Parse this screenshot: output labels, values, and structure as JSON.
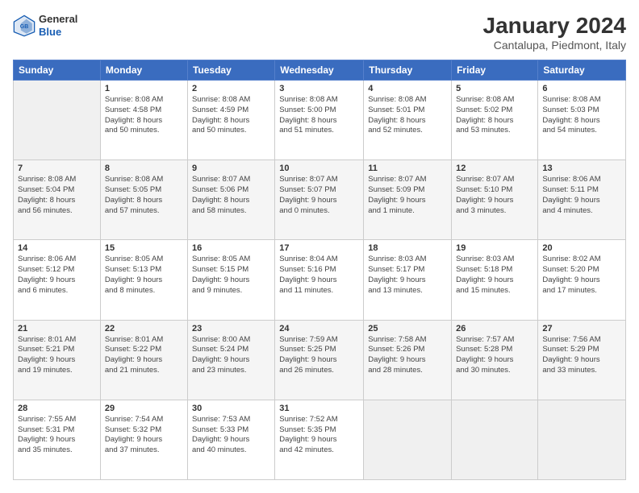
{
  "header": {
    "logo_general": "General",
    "logo_blue": "Blue",
    "month_title": "January 2024",
    "location": "Cantalupa, Piedmont, Italy"
  },
  "days_of_week": [
    "Sunday",
    "Monday",
    "Tuesday",
    "Wednesday",
    "Thursday",
    "Friday",
    "Saturday"
  ],
  "weeks": [
    [
      {
        "day": "",
        "info": ""
      },
      {
        "day": "1",
        "info": "Sunrise: 8:08 AM\nSunset: 4:58 PM\nDaylight: 8 hours\nand 50 minutes."
      },
      {
        "day": "2",
        "info": "Sunrise: 8:08 AM\nSunset: 4:59 PM\nDaylight: 8 hours\nand 50 minutes."
      },
      {
        "day": "3",
        "info": "Sunrise: 8:08 AM\nSunset: 5:00 PM\nDaylight: 8 hours\nand 51 minutes."
      },
      {
        "day": "4",
        "info": "Sunrise: 8:08 AM\nSunset: 5:01 PM\nDaylight: 8 hours\nand 52 minutes."
      },
      {
        "day": "5",
        "info": "Sunrise: 8:08 AM\nSunset: 5:02 PM\nDaylight: 8 hours\nand 53 minutes."
      },
      {
        "day": "6",
        "info": "Sunrise: 8:08 AM\nSunset: 5:03 PM\nDaylight: 8 hours\nand 54 minutes."
      }
    ],
    [
      {
        "day": "7",
        "info": "Sunrise: 8:08 AM\nSunset: 5:04 PM\nDaylight: 8 hours\nand 56 minutes."
      },
      {
        "day": "8",
        "info": "Sunrise: 8:08 AM\nSunset: 5:05 PM\nDaylight: 8 hours\nand 57 minutes."
      },
      {
        "day": "9",
        "info": "Sunrise: 8:07 AM\nSunset: 5:06 PM\nDaylight: 8 hours\nand 58 minutes."
      },
      {
        "day": "10",
        "info": "Sunrise: 8:07 AM\nSunset: 5:07 PM\nDaylight: 9 hours\nand 0 minutes."
      },
      {
        "day": "11",
        "info": "Sunrise: 8:07 AM\nSunset: 5:09 PM\nDaylight: 9 hours\nand 1 minute."
      },
      {
        "day": "12",
        "info": "Sunrise: 8:07 AM\nSunset: 5:10 PM\nDaylight: 9 hours\nand 3 minutes."
      },
      {
        "day": "13",
        "info": "Sunrise: 8:06 AM\nSunset: 5:11 PM\nDaylight: 9 hours\nand 4 minutes."
      }
    ],
    [
      {
        "day": "14",
        "info": "Sunrise: 8:06 AM\nSunset: 5:12 PM\nDaylight: 9 hours\nand 6 minutes."
      },
      {
        "day": "15",
        "info": "Sunrise: 8:05 AM\nSunset: 5:13 PM\nDaylight: 9 hours\nand 8 minutes."
      },
      {
        "day": "16",
        "info": "Sunrise: 8:05 AM\nSunset: 5:15 PM\nDaylight: 9 hours\nand 9 minutes."
      },
      {
        "day": "17",
        "info": "Sunrise: 8:04 AM\nSunset: 5:16 PM\nDaylight: 9 hours\nand 11 minutes."
      },
      {
        "day": "18",
        "info": "Sunrise: 8:03 AM\nSunset: 5:17 PM\nDaylight: 9 hours\nand 13 minutes."
      },
      {
        "day": "19",
        "info": "Sunrise: 8:03 AM\nSunset: 5:18 PM\nDaylight: 9 hours\nand 15 minutes."
      },
      {
        "day": "20",
        "info": "Sunrise: 8:02 AM\nSunset: 5:20 PM\nDaylight: 9 hours\nand 17 minutes."
      }
    ],
    [
      {
        "day": "21",
        "info": "Sunrise: 8:01 AM\nSunset: 5:21 PM\nDaylight: 9 hours\nand 19 minutes."
      },
      {
        "day": "22",
        "info": "Sunrise: 8:01 AM\nSunset: 5:22 PM\nDaylight: 9 hours\nand 21 minutes."
      },
      {
        "day": "23",
        "info": "Sunrise: 8:00 AM\nSunset: 5:24 PM\nDaylight: 9 hours\nand 23 minutes."
      },
      {
        "day": "24",
        "info": "Sunrise: 7:59 AM\nSunset: 5:25 PM\nDaylight: 9 hours\nand 26 minutes."
      },
      {
        "day": "25",
        "info": "Sunrise: 7:58 AM\nSunset: 5:26 PM\nDaylight: 9 hours\nand 28 minutes."
      },
      {
        "day": "26",
        "info": "Sunrise: 7:57 AM\nSunset: 5:28 PM\nDaylight: 9 hours\nand 30 minutes."
      },
      {
        "day": "27",
        "info": "Sunrise: 7:56 AM\nSunset: 5:29 PM\nDaylight: 9 hours\nand 33 minutes."
      }
    ],
    [
      {
        "day": "28",
        "info": "Sunrise: 7:55 AM\nSunset: 5:31 PM\nDaylight: 9 hours\nand 35 minutes."
      },
      {
        "day": "29",
        "info": "Sunrise: 7:54 AM\nSunset: 5:32 PM\nDaylight: 9 hours\nand 37 minutes."
      },
      {
        "day": "30",
        "info": "Sunrise: 7:53 AM\nSunset: 5:33 PM\nDaylight: 9 hours\nand 40 minutes."
      },
      {
        "day": "31",
        "info": "Sunrise: 7:52 AM\nSunset: 5:35 PM\nDaylight: 9 hours\nand 42 minutes."
      },
      {
        "day": "",
        "info": ""
      },
      {
        "day": "",
        "info": ""
      },
      {
        "day": "",
        "info": ""
      }
    ]
  ]
}
